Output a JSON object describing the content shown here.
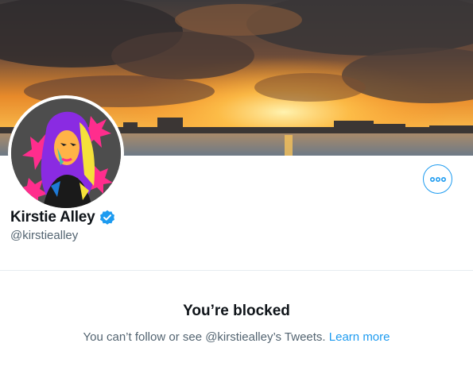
{
  "profile": {
    "display_name": "Kirstie Alley",
    "handle": "@kirstiealley",
    "verified": true
  },
  "banner": {
    "description": "sunset-over-water"
  },
  "more_button": {
    "icon": "more-dots-icon"
  },
  "blocked": {
    "title": "You’re blocked",
    "message": "You can’t follow or see @kirstiealley’s Tweets.",
    "link_text": "Learn more"
  },
  "colors": {
    "accent": "#1d9bf0",
    "text_primary": "#0f1419",
    "text_secondary": "#536471",
    "divider": "#e6ecf0"
  }
}
